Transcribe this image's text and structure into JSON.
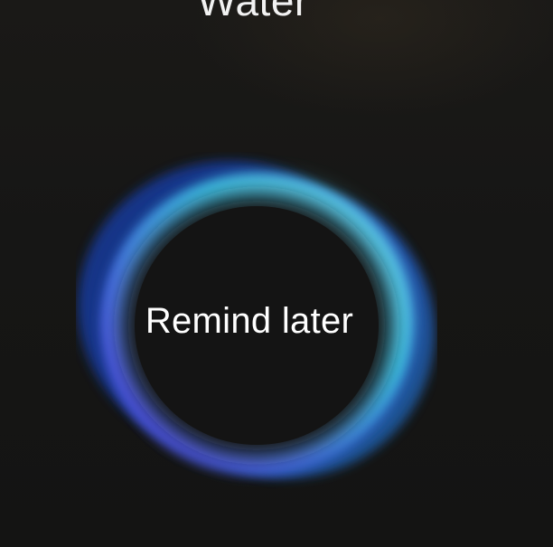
{
  "header": {
    "title": "Water"
  },
  "reminder": {
    "button_label": "Remind later"
  },
  "colors": {
    "background": "#151514",
    "ring_cyan": "#3fd2f0",
    "ring_blue": "#2a6ee0",
    "ring_violet": "#6a45e0"
  }
}
